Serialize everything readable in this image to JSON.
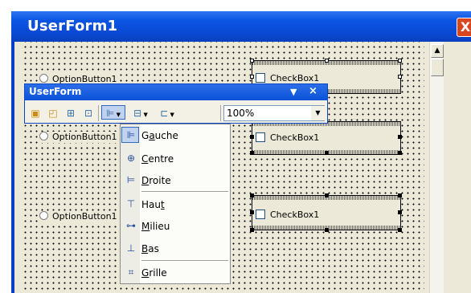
{
  "window": {
    "title": "UserForm1",
    "close_glyph": "X"
  },
  "form": {
    "option_buttons": [
      "OptionButton1",
      "OptionButton1",
      "OptionButton1"
    ],
    "checkboxes": [
      "CheckBox1",
      "CheckBox1",
      "CheckBox1"
    ]
  },
  "toolbar": {
    "title": "UserForm",
    "menu_arrow": "▼",
    "close": "×",
    "zoom_value": "100%",
    "icons": [
      "bring-to-front-icon",
      "send-to-back-icon",
      "group-icon",
      "ungroup-icon",
      "align-icon",
      "center-in-form-icon",
      "make-same-size-icon"
    ]
  },
  "align_menu": {
    "items": [
      {
        "label": "Gauche",
        "icon": "align-left-icon"
      },
      {
        "label": "Centre",
        "icon": "align-center-icon"
      },
      {
        "label": "Droite",
        "icon": "align-right-icon"
      },
      {
        "label": "Haut",
        "icon": "align-top-icon"
      },
      {
        "label": "Milieu",
        "icon": "align-middle-icon"
      },
      {
        "label": "Bas",
        "icon": "align-bottom-icon"
      },
      {
        "label": "Grille",
        "icon": "align-to-grid-icon"
      }
    ],
    "highlighted_index": 0
  },
  "colors": {
    "titlebar": "#0a48d2",
    "menu_highlight": "#c1d2ee",
    "form_background": "#ece9d8"
  }
}
